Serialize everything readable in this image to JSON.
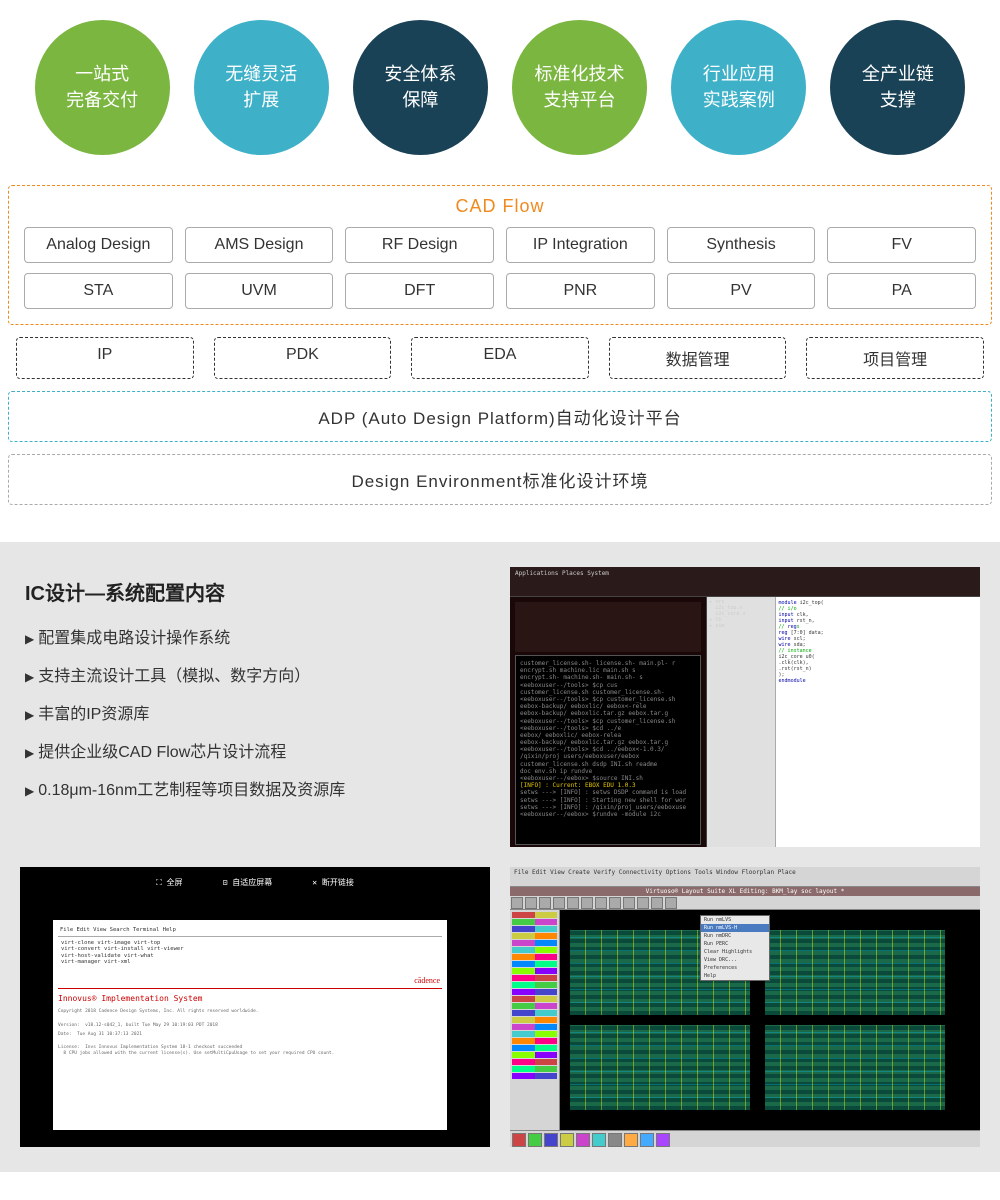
{
  "circles": [
    {
      "text": "一站式\n完备交付",
      "cls": "c-green"
    },
    {
      "text": "无缝灵活\n扩展",
      "cls": "c-teal"
    },
    {
      "text": "安全体系\n保障",
      "cls": "c-navy"
    },
    {
      "text": "标准化技术\n支持平台",
      "cls": "c-green"
    },
    {
      "text": "行业应用\n实践案例",
      "cls": "c-teal"
    },
    {
      "text": "全产业链\n支撑",
      "cls": "c-navy"
    }
  ],
  "cadflow": {
    "title": "CAD Flow",
    "row1": [
      "Analog Design",
      "AMS Design",
      "RF Design",
      "IP Integration",
      "Synthesis",
      "FV"
    ],
    "row2": [
      "STA",
      "UVM",
      "DFT",
      "PNR",
      "PV",
      "PA"
    ]
  },
  "dashed_cells": [
    {
      "text": "IP",
      "color": "green-border"
    },
    {
      "text": "PDK",
      "color": "green-border"
    },
    {
      "text": "EDA",
      "color": "orange-border"
    },
    {
      "text": "数据管理",
      "color": "cyan-border"
    },
    {
      "text": "项目管理",
      "color": "cyan-border"
    }
  ],
  "adp": "ADP (Auto Design Platform)自动化设计平台",
  "design_env": "Design Environment标准化设计环境",
  "info": {
    "title": "IC设计—系统配置内容",
    "items": [
      "配置集成电路设计操作系统",
      "支持主流设计工具（模拟、数字方向）",
      "丰富的IP资源库",
      "提供企业级CAD Flow芯片设计流程",
      "0.18μm-16nm工艺制程等项目数据及资源库"
    ]
  },
  "shot1": {
    "header": "Applications  Places  System",
    "term_lines": [
      "customer_license.sh-  license.sh-  main.pl-  r",
      "encrypt.sh            machine.lic  main.sh   s",
      "encrypt.sh-           machine.sh-  main.sh-  s",
      "<eeboxuser--/tools> $cp cus",
      "customer_license.sh   customer_license.sh-",
      "<eeboxuser--/tools> $cp customer_license.sh",
      "eebox-backup/   eeboxlic/       eebox<-rele",
      "eebox-backup/   eeboxlic.tar.gz eebox.tar.g",
      "<eeboxuser--/tools> $cp customer_license.sh",
      "<eeboxuser--/tools> $cd ../e",
      "eebox/          eeboxlic/       eebox-relea",
      "eebox-backup/   eeboxlic.tar.gz eebox.tar.g",
      "<eeboxuser--/tools> $cd ../eebox<-1.0.3/",
      "/qixin/proj users/eeboxuser/eebox",
      "customer_license.sh  dsdp     INI.sh   readme",
      "doc                  env.sh  ip       rundve",
      "<eeboxuser--/eebox> $source INI.sh"
    ],
    "term_yellow": "[INFO] : Current: EBOX EDU 1.0.3",
    "term_tail": [
      "setws ---> [INFO] : setws DSDP command is load",
      "setws ---> [INFO] : Starting new shell for wor",
      "setws ---> [INFO] : /qixin/proj_users/eeboxuse",
      "<eeboxuser--/eebox> $rundve -module i2c"
    ],
    "code_lines": [
      "module i2c_top(",
      "  // i/o",
      "  input clk,",
      "  input rst_n,",
      "  // regs",
      "  reg [7:0] data;",
      "  wire scl;",
      "  wire sda;",
      "  // instance",
      "  i2c_core u0(",
      "    .clk(clk),",
      "    .rst(rst_n)",
      "  );",
      "endmodule"
    ]
  },
  "shot2": {
    "top_items": [
      "⛶ 全屏",
      "⊡ 自适应屏幕",
      "✕ 断开链接"
    ],
    "menu": "File  Edit  View  Search  Terminal  Help",
    "cmds": [
      "virt-clone    virt-image    virt-top",
      "virt-convert  virt-install  virt-viewer",
      "virt-host-validate  virt-what",
      "virt-manager  virt-xml"
    ],
    "brand": "cādence",
    "product": "Innovus® Implementation System",
    "copyright": "Copyright 2018 Cadence Design Systems, Inc. All rights reserved worldwide.",
    "version": "v18.12-s042_1, built Tue May 29 10:19:03 PDT 2018",
    "date": "Tue Aug 31 10:37:13 2021"
  },
  "shot3": {
    "menu": "File  Edit  View  Create  Verify  Connectivity  Options  Tools  Window  Floorplan  Place",
    "title": "Virtuoso® Layout Suite XL Editing: BKM_lay soc layout *",
    "ctx_menu": [
      "Run nmLVS",
      "Run nmLVS-H",
      "Run nmDRC",
      "Run PERC",
      "Clear Highlights",
      "View DRC...",
      "Preferences",
      "Help"
    ]
  }
}
